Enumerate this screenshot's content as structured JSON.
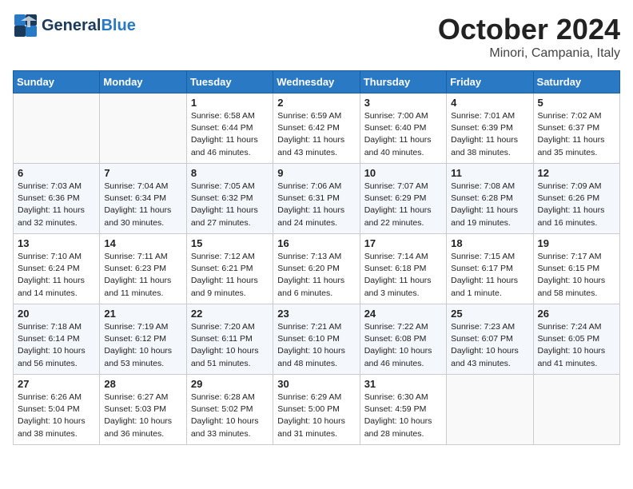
{
  "header": {
    "logo_line1": "General",
    "logo_line2": "Blue",
    "month": "October 2024",
    "location": "Minori, Campania, Italy"
  },
  "weekdays": [
    "Sunday",
    "Monday",
    "Tuesday",
    "Wednesday",
    "Thursday",
    "Friday",
    "Saturday"
  ],
  "weeks": [
    [
      {
        "day": "",
        "info": ""
      },
      {
        "day": "",
        "info": ""
      },
      {
        "day": "1",
        "info": "Sunrise: 6:58 AM\nSunset: 6:44 PM\nDaylight: 11 hours\nand 46 minutes."
      },
      {
        "day": "2",
        "info": "Sunrise: 6:59 AM\nSunset: 6:42 PM\nDaylight: 11 hours\nand 43 minutes."
      },
      {
        "day": "3",
        "info": "Sunrise: 7:00 AM\nSunset: 6:40 PM\nDaylight: 11 hours\nand 40 minutes."
      },
      {
        "day": "4",
        "info": "Sunrise: 7:01 AM\nSunset: 6:39 PM\nDaylight: 11 hours\nand 38 minutes."
      },
      {
        "day": "5",
        "info": "Sunrise: 7:02 AM\nSunset: 6:37 PM\nDaylight: 11 hours\nand 35 minutes."
      }
    ],
    [
      {
        "day": "6",
        "info": "Sunrise: 7:03 AM\nSunset: 6:36 PM\nDaylight: 11 hours\nand 32 minutes."
      },
      {
        "day": "7",
        "info": "Sunrise: 7:04 AM\nSunset: 6:34 PM\nDaylight: 11 hours\nand 30 minutes."
      },
      {
        "day": "8",
        "info": "Sunrise: 7:05 AM\nSunset: 6:32 PM\nDaylight: 11 hours\nand 27 minutes."
      },
      {
        "day": "9",
        "info": "Sunrise: 7:06 AM\nSunset: 6:31 PM\nDaylight: 11 hours\nand 24 minutes."
      },
      {
        "day": "10",
        "info": "Sunrise: 7:07 AM\nSunset: 6:29 PM\nDaylight: 11 hours\nand 22 minutes."
      },
      {
        "day": "11",
        "info": "Sunrise: 7:08 AM\nSunset: 6:28 PM\nDaylight: 11 hours\nand 19 minutes."
      },
      {
        "day": "12",
        "info": "Sunrise: 7:09 AM\nSunset: 6:26 PM\nDaylight: 11 hours\nand 16 minutes."
      }
    ],
    [
      {
        "day": "13",
        "info": "Sunrise: 7:10 AM\nSunset: 6:24 PM\nDaylight: 11 hours\nand 14 minutes."
      },
      {
        "day": "14",
        "info": "Sunrise: 7:11 AM\nSunset: 6:23 PM\nDaylight: 11 hours\nand 11 minutes."
      },
      {
        "day": "15",
        "info": "Sunrise: 7:12 AM\nSunset: 6:21 PM\nDaylight: 11 hours\nand 9 minutes."
      },
      {
        "day": "16",
        "info": "Sunrise: 7:13 AM\nSunset: 6:20 PM\nDaylight: 11 hours\nand 6 minutes."
      },
      {
        "day": "17",
        "info": "Sunrise: 7:14 AM\nSunset: 6:18 PM\nDaylight: 11 hours\nand 3 minutes."
      },
      {
        "day": "18",
        "info": "Sunrise: 7:15 AM\nSunset: 6:17 PM\nDaylight: 11 hours\nand 1 minute."
      },
      {
        "day": "19",
        "info": "Sunrise: 7:17 AM\nSunset: 6:15 PM\nDaylight: 10 hours\nand 58 minutes."
      }
    ],
    [
      {
        "day": "20",
        "info": "Sunrise: 7:18 AM\nSunset: 6:14 PM\nDaylight: 10 hours\nand 56 minutes."
      },
      {
        "day": "21",
        "info": "Sunrise: 7:19 AM\nSunset: 6:12 PM\nDaylight: 10 hours\nand 53 minutes."
      },
      {
        "day": "22",
        "info": "Sunrise: 7:20 AM\nSunset: 6:11 PM\nDaylight: 10 hours\nand 51 minutes."
      },
      {
        "day": "23",
        "info": "Sunrise: 7:21 AM\nSunset: 6:10 PM\nDaylight: 10 hours\nand 48 minutes."
      },
      {
        "day": "24",
        "info": "Sunrise: 7:22 AM\nSunset: 6:08 PM\nDaylight: 10 hours\nand 46 minutes."
      },
      {
        "day": "25",
        "info": "Sunrise: 7:23 AM\nSunset: 6:07 PM\nDaylight: 10 hours\nand 43 minutes."
      },
      {
        "day": "26",
        "info": "Sunrise: 7:24 AM\nSunset: 6:05 PM\nDaylight: 10 hours\nand 41 minutes."
      }
    ],
    [
      {
        "day": "27",
        "info": "Sunrise: 6:26 AM\nSunset: 5:04 PM\nDaylight: 10 hours\nand 38 minutes."
      },
      {
        "day": "28",
        "info": "Sunrise: 6:27 AM\nSunset: 5:03 PM\nDaylight: 10 hours\nand 36 minutes."
      },
      {
        "day": "29",
        "info": "Sunrise: 6:28 AM\nSunset: 5:02 PM\nDaylight: 10 hours\nand 33 minutes."
      },
      {
        "day": "30",
        "info": "Sunrise: 6:29 AM\nSunset: 5:00 PM\nDaylight: 10 hours\nand 31 minutes."
      },
      {
        "day": "31",
        "info": "Sunrise: 6:30 AM\nSunset: 4:59 PM\nDaylight: 10 hours\nand 28 minutes."
      },
      {
        "day": "",
        "info": ""
      },
      {
        "day": "",
        "info": ""
      }
    ]
  ]
}
